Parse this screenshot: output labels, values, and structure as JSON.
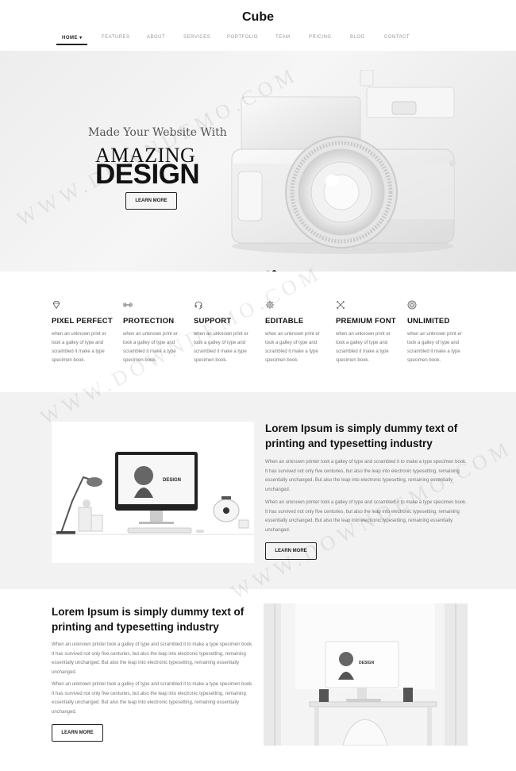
{
  "header": {
    "logo": "Cube",
    "nav": [
      {
        "label": "HOME ▾",
        "active": true
      },
      {
        "label": "FEATURES"
      },
      {
        "label": "ABOUT"
      },
      {
        "label": "SERVICES"
      },
      {
        "label": "PORTFOLIO"
      },
      {
        "label": "TEAM"
      },
      {
        "label": "PRICING"
      },
      {
        "label": "BLOG"
      },
      {
        "label": "CONTACT"
      }
    ]
  },
  "hero": {
    "subtitle": "Made Your Website With",
    "title_line1": "AMAZING",
    "title_line2": "DESIGN",
    "button": "LEARN MORE",
    "slides": 2,
    "active_slide": 2
  },
  "features": [
    {
      "icon": "diamond-icon",
      "title": "PIXEL PERFECT",
      "text": "when an unknown print er took a galley of type and scrambled it make a type specimen book."
    },
    {
      "icon": "dumbbell-icon",
      "title": "PROTECTION",
      "text": "when an unknown print er took a galley of type and scrambled it make a type specimen book."
    },
    {
      "icon": "headset-icon",
      "title": "SUPPORT",
      "text": "when an unknown print er took a galley of type and scrambled it make a type specimen book."
    },
    {
      "icon": "gear-icon",
      "title": "EDITABLE",
      "text": "when an unknown print er took a galley of type and scrambled it make a type specimen book."
    },
    {
      "icon": "tools-icon",
      "title": "PREMIUM FONT",
      "text": "when an unknown print er took a galley of type and scrambled it make a type specimen book."
    },
    {
      "icon": "globe-icon",
      "title": "UNLIMITED",
      "text": "when an unknown print er took a galley of type and scrambled it make a type specimen book."
    }
  ],
  "section2": {
    "heading": "Lorem Ipsum is simply dummy text of printing and typesetting industry",
    "para1": "When an unknown printer took a galley of type and scrambled it to make a type specimen book. It has survived not only five centuries, but also the leap into electronic typesetting, remaining essentially unchanged. But also the leap into electronic typesetting, remaining essentially unchanged.",
    "para2": "When an unknown printer took a galley of type and scrambled it to make a type specimen book. It has survived not only five centuries, but also the leap into electronic typesetting, remaining essentially unchanged. But also the leap into electronic typesetting, remaining essentially unchanged.",
    "button": "LEARN MORE",
    "screen_text": "DESIGN"
  },
  "section3": {
    "heading": "Lorem Ipsum is simply dummy text of printing and typesetting industry",
    "para1": "When an unknown printer took a galley of type and scrambled it to make a type specimen book. It has survived not only five centuries, but also the leap into electronic typesetting, remaining essentially unchanged. But also the leap into electronic typesetting, remaining essentially unchanged.",
    "para2": "When an unknown printer took a galley of type and scrambled it to make a type specimen book. It has survived not only five centuries, but also the leap into electronic typesetting, remaining essentially unchanged. But also the leap into electronic typesetting, remaining essentially unchanged.",
    "button": "LEARN MORE",
    "screen_text": "DESIGN"
  },
  "watermark": "WWW.DOWNDEMO.COM"
}
